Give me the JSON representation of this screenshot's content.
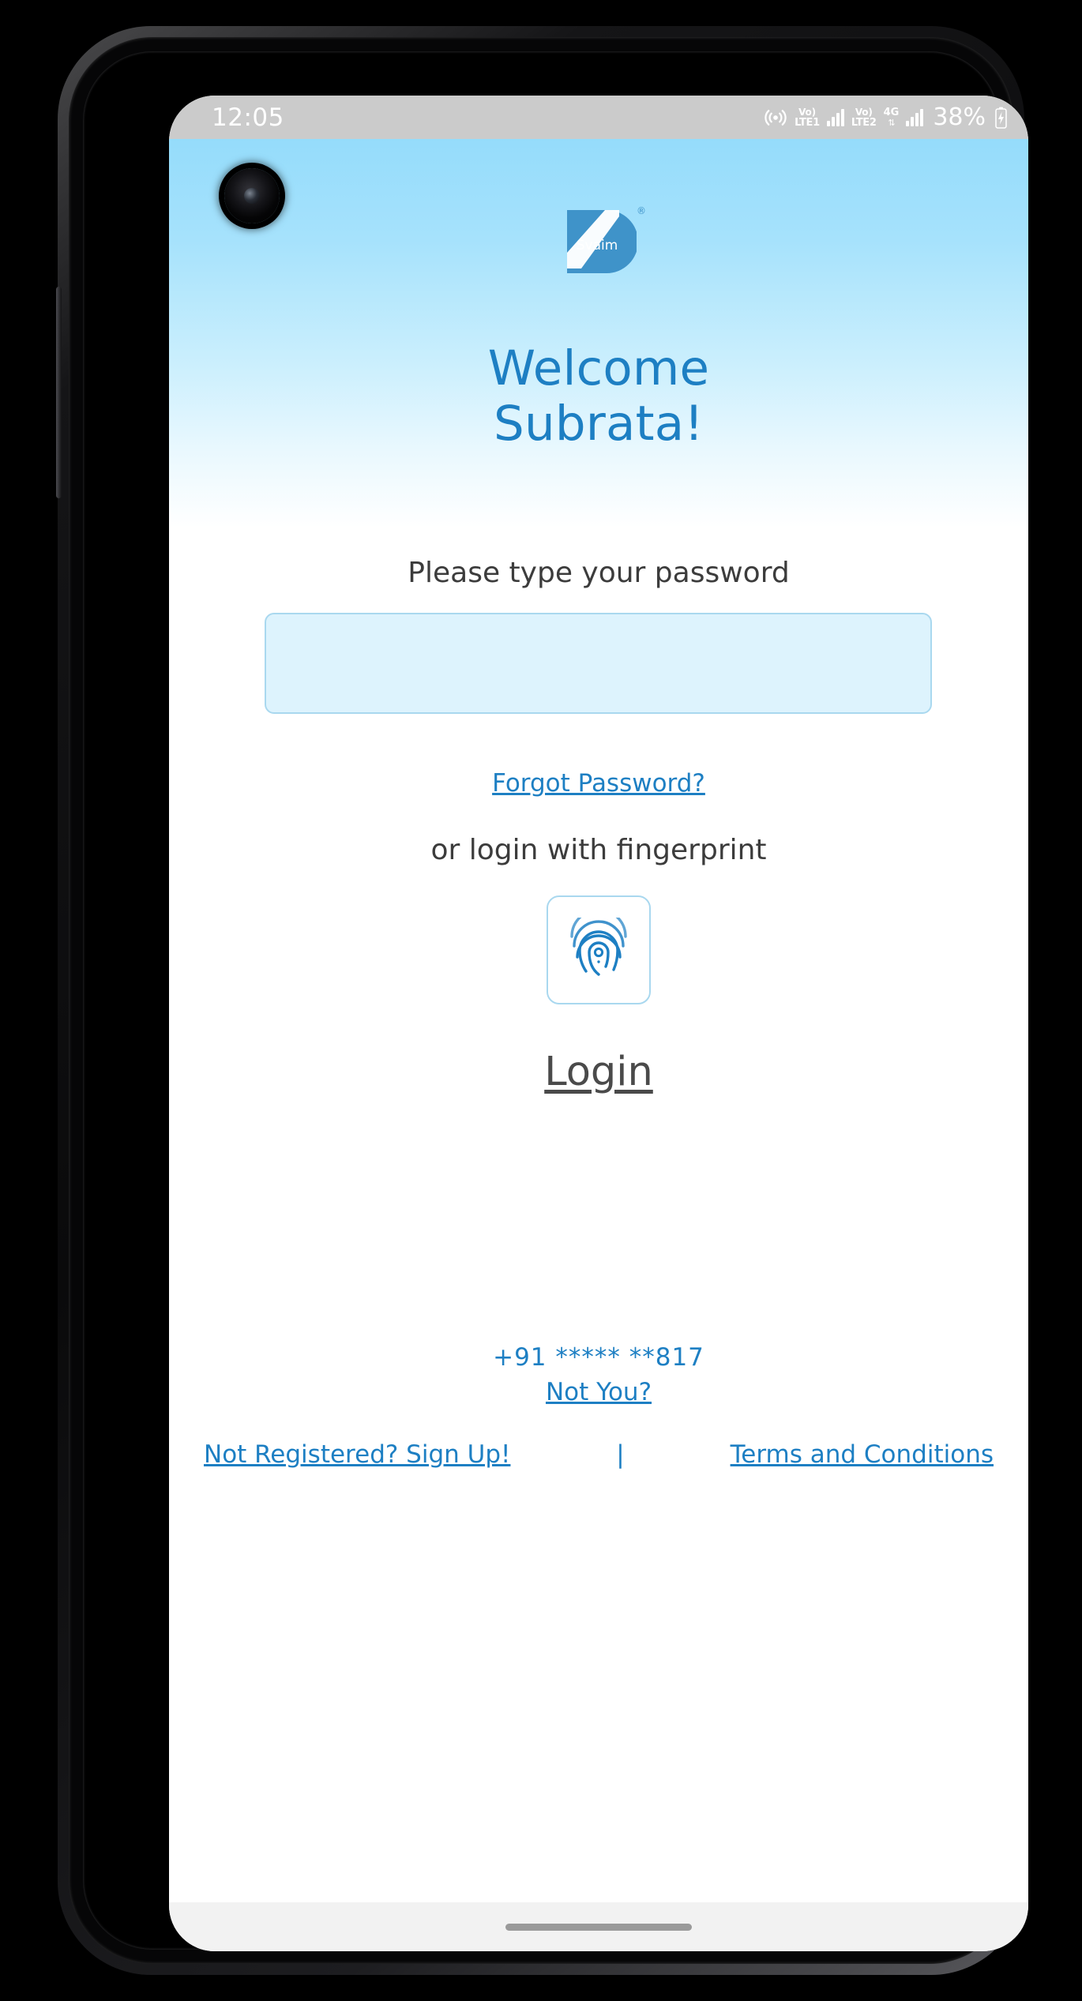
{
  "device": {
    "type": "android-smartphone",
    "camera": "front-camera-punch-hole"
  },
  "status_bar": {
    "time": "12:05",
    "battery_percent": "38%",
    "icons": [
      {
        "name": "wifi-calling-icon",
        "label": "wifi-calling"
      },
      {
        "name": "volte-sim1-icon",
        "top": "Vo)",
        "bottom": "LTE1"
      },
      {
        "name": "signal-sim1-icon",
        "label": "signal-bars",
        "bars": 4
      },
      {
        "name": "volte-sim2-icon",
        "top": "Vo)",
        "bottom": "LTE2"
      },
      {
        "name": "network-4g-icon",
        "label": "4G",
        "arrows": "⇅"
      },
      {
        "name": "signal-sim2-icon",
        "label": "signal-bars",
        "bars": 4
      },
      {
        "name": "battery-icon",
        "label": "battery-charging"
      }
    ]
  },
  "brand": {
    "name": "Svaim",
    "trademark": "®",
    "logo_icon": "svaim-logo-icon",
    "logo_color": "#3f93c9",
    "logo_text_color": "#ffffff"
  },
  "screen": {
    "welcome_line1": "Welcome",
    "welcome_line2": "Subrata!",
    "password_prompt": "Please type your password",
    "password_value": "",
    "password_placeholder": "",
    "forgot_password_label": "Forgot Password?",
    "fingerprint_prompt": "or login with fingerprint",
    "fingerprint_icon": "fingerprint-icon",
    "login_label": "Login",
    "phone_number": "+91 ***** **817",
    "not_you_label": "Not You?",
    "signup_label": "Not Registered? Sign Up!",
    "separator": "|",
    "terms_label": "Terms and Conditions"
  },
  "colors": {
    "accent_blue": "#1d7fc3",
    "gradient_top": "#95dcfb",
    "gradient_bottom": "#ffffff",
    "input_fill": "#ddf3fd",
    "input_border": "#a9d8ef",
    "status_bar_bg": "#cbcbcb",
    "text_dark": "#3c3c3c",
    "login_text": "#4a4a4a"
  }
}
